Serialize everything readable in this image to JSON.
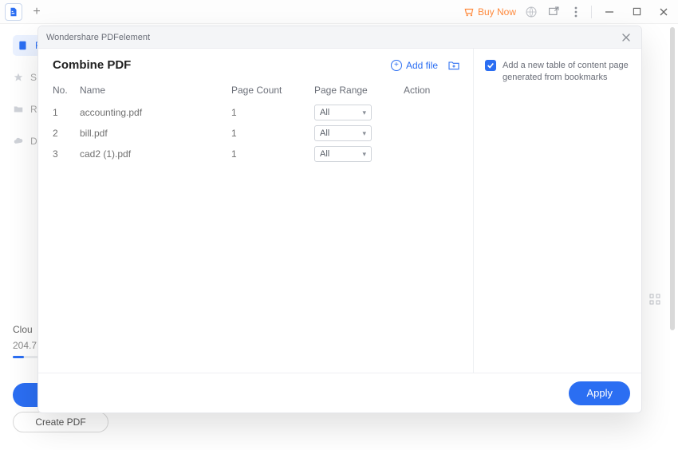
{
  "titlebar": {
    "buy_now": "Buy Now"
  },
  "sidebar": {
    "items": [
      {
        "label": "R"
      },
      {
        "label": "S"
      },
      {
        "label": "R"
      },
      {
        "label": "D"
      }
    ]
  },
  "cloud": {
    "title": "Clou",
    "size": "204.7"
  },
  "create_pdf": "Create PDF",
  "dialog": {
    "window_title": "Wondershare PDFelement",
    "title": "Combine PDF",
    "add_file": "Add file",
    "columns": {
      "no": "No.",
      "name": "Name",
      "page_count": "Page Count",
      "page_range": "Page Range",
      "action": "Action"
    },
    "rows": [
      {
        "no": "1",
        "name": "accounting.pdf",
        "page_count": "1",
        "page_range": "All"
      },
      {
        "no": "2",
        "name": "bill.pdf",
        "page_count": "1",
        "page_range": "All"
      },
      {
        "no": "3",
        "name": "cad2 (1).pdf",
        "page_count": "1",
        "page_range": "All"
      }
    ],
    "side_option": "Add a new table of content page generated from bookmarks",
    "apply": "Apply"
  }
}
